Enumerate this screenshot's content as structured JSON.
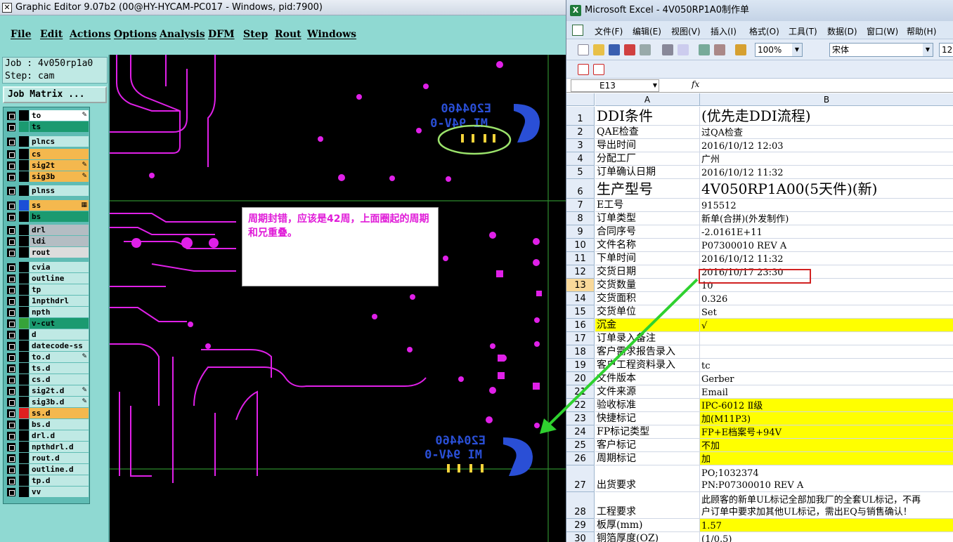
{
  "graphic_editor": {
    "title": "Graphic Editor 9.07b2 (00@HY-HYCAM-PC017 - Windows, pid:7900)",
    "menu": [
      "File",
      "Edit",
      "Actions",
      "Options",
      "Analysis",
      "DFM",
      "Step",
      "Rout",
      "Windows"
    ],
    "job_line": "Job : 4v050rp1a0",
    "step_line": "Step: cam",
    "job_matrix_button": "Job Matrix ...",
    "layers": [
      {
        "name": "to",
        "bg": "#ffffff",
        "mark": "✎"
      },
      {
        "name": "ts",
        "bg": "#1b9a70",
        "mark": ""
      },
      {
        "name": "plncs",
        "bg": "#bfe9e4",
        "mark": ""
      },
      {
        "name": "cs",
        "bg": "#f4b84e",
        "mark": ""
      },
      {
        "name": "sig2t",
        "bg": "#f4b84e",
        "mark": "✎"
      },
      {
        "name": "sig3b",
        "bg": "#f4b84e",
        "mark": "✎"
      },
      {
        "name": "plnss",
        "bg": "#bfe9e4",
        "mark": ""
      },
      {
        "name": "ss",
        "bg": "#f4b84e",
        "mark": "▦"
      },
      {
        "name": "bs",
        "bg": "#1b9a70",
        "mark": ""
      },
      {
        "name": "drl",
        "bg": "#b4bdc3",
        "mark": ""
      },
      {
        "name": "ldi",
        "bg": "#b4bdc3",
        "mark": ""
      },
      {
        "name": "rout",
        "bg": "#dcdcdc",
        "mark": ""
      },
      {
        "name": "cvia",
        "bg": "#bfe9e4",
        "mark": ""
      },
      {
        "name": "outline",
        "bg": "#bfe9e4",
        "mark": ""
      },
      {
        "name": "tp",
        "bg": "#bfe9e4",
        "mark": ""
      },
      {
        "name": "1npthdrl",
        "bg": "#bfe9e4",
        "mark": ""
      },
      {
        "name": "npth",
        "bg": "#bfe9e4",
        "mark": ""
      },
      {
        "name": "v-cut",
        "bg": "#1b9a70",
        "mark": ""
      },
      {
        "name": "d",
        "bg": "#bfe9e4",
        "mark": ""
      },
      {
        "name": "datecode-ss",
        "bg": "#bfe9e4",
        "mark": ""
      },
      {
        "name": "to.d",
        "bg": "#bfe9e4",
        "mark": "✎"
      },
      {
        "name": "ts.d",
        "bg": "#bfe9e4",
        "mark": ""
      },
      {
        "name": "cs.d",
        "bg": "#bfe9e4",
        "mark": ""
      },
      {
        "name": "sig2t.d",
        "bg": "#bfe9e4",
        "mark": "✎"
      },
      {
        "name": "sig3b.d",
        "bg": "#bfe9e4",
        "mark": "✎"
      },
      {
        "name": "ss.d",
        "bg": "#f4b84e",
        "mark": ""
      },
      {
        "name": "bs.d",
        "bg": "#bfe9e4",
        "mark": ""
      },
      {
        "name": "drl.d",
        "bg": "#bfe9e4",
        "mark": ""
      },
      {
        "name": "npthdrl.d",
        "bg": "#bfe9e4",
        "mark": ""
      },
      {
        "name": "rout.d",
        "bg": "#bfe9e4",
        "mark": ""
      },
      {
        "name": "outline.d",
        "bg": "#bfe9e4",
        "mark": ""
      },
      {
        "name": "tp.d",
        "bg": "#bfe9e4",
        "mark": ""
      },
      {
        "name": "vv",
        "bg": "#bfe9e4",
        "mark": ""
      }
    ],
    "pcb_text_1": "E204460",
    "pcb_text_2": "MI 94V-0",
    "note": "周期封错，应该是42周，上面圈起的周期和兄重叠。"
  },
  "excel": {
    "title": "Microsoft Excel - 4V050RP1A0制作单",
    "menu": [
      "文件(F)",
      "编辑(E)",
      "视图(V)",
      "插入(I)",
      "格式(O)",
      "工具(T)",
      "数据(D)",
      "窗口(W)",
      "帮助(H)"
    ],
    "zoom": "100%",
    "font": "宋体",
    "font_size": "12",
    "name_box": "E13",
    "fx": "fx",
    "col_a": "A",
    "col_b": "B",
    "rows": [
      {
        "n": "1",
        "a": "DDI条件",
        "b": "(优先走DDI流程)",
        "big": true
      },
      {
        "n": "2",
        "a": "QAE检查",
        "b": "过QA检查"
      },
      {
        "n": "3",
        "a": "导出时间",
        "b": "2016/10/12 12:03"
      },
      {
        "n": "4",
        "a": "分配工厂",
        "b": "广州"
      },
      {
        "n": "5",
        "a": "订单确认日期",
        "b": "2016/10/12 11:32"
      },
      {
        "n": "6",
        "a": "生产型号",
        "b": "4V050RP1A00(5天件)(新)",
        "big": true
      },
      {
        "n": "7",
        "a": "E工号",
        "b": "915512"
      },
      {
        "n": "8",
        "a": "订单类型",
        "b": "新单(合拼)(外发制作)"
      },
      {
        "n": "9",
        "a": "合同序号",
        "b": "-2.0161E+11"
      },
      {
        "n": "10",
        "a": "文件名称",
        "b": "P07300010 REV A"
      },
      {
        "n": "11",
        "a": "下单时间",
        "b": "2016/10/12 11:32"
      },
      {
        "n": "12",
        "a": "交货日期",
        "b": "2016/10/17 23:30"
      },
      {
        "n": "13",
        "a": "交货数量",
        "b": "10"
      },
      {
        "n": "14",
        "a": "交货面积",
        "b": "0.326"
      },
      {
        "n": "15",
        "a": "交货单位",
        "b": "Set"
      },
      {
        "n": "16",
        "a": "沉金",
        "b": "√",
        "yel_a": true,
        "yel_b": true
      },
      {
        "n": "17",
        "a": "订单录入备注",
        "b": ""
      },
      {
        "n": "18",
        "a": "客户需求报告录入",
        "b": ""
      },
      {
        "n": "19",
        "a": "客户工程资料录入",
        "b": "tc"
      },
      {
        "n": "20",
        "a": "文件版本",
        "b": "Gerber"
      },
      {
        "n": "21",
        "a": "文件来源",
        "b": "Email"
      },
      {
        "n": "22",
        "a": "验收标准",
        "b": "IPC-6012 Ⅱ级",
        "yel_b": true
      },
      {
        "n": "23",
        "a": "快捷标记",
        "b": "加(M11P3)",
        "yel_b": true
      },
      {
        "n": "24",
        "a": "FP标记类型",
        "b": "FP+E档案号+94V",
        "yel_b": true
      },
      {
        "n": "25",
        "a": "客户标记",
        "b": "不加",
        "yel_b": true
      },
      {
        "n": "26",
        "a": "周期标记",
        "b": "加",
        "yel_b": true
      },
      {
        "n": "27",
        "a": "出货要求",
        "b": "PO;1032374",
        "b2": "PN:P07300010 REV A"
      },
      {
        "n": "28",
        "a": "工程要求",
        "b": "此顾客的新单UL标记全部加我厂的全套UL标记，不再",
        "b2": "户订单中要求加其他UL标记，需出EQ与销售确认！"
      },
      {
        "n": "29",
        "a": "板厚(mm)",
        "b": "1.57",
        "yel_b": true
      },
      {
        "n": "30",
        "a": "铜箔厚度(OZ)",
        "b": "(1/0.5)"
      }
    ]
  }
}
